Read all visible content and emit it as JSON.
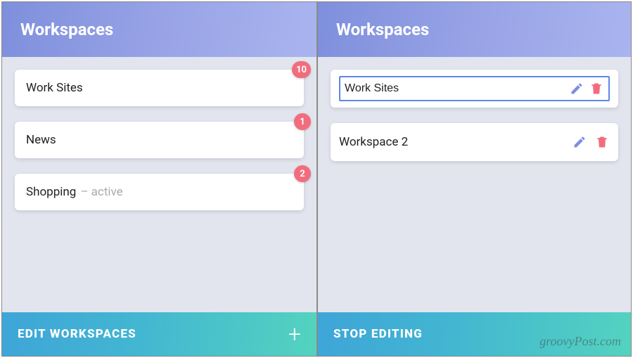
{
  "left": {
    "header": {
      "title": "Workspaces"
    },
    "items": [
      {
        "label": "Work Sites",
        "badge": "10"
      },
      {
        "label": "News",
        "badge": "1"
      },
      {
        "label": "Shopping",
        "secondary": "– active",
        "badge": "2"
      }
    ],
    "footer": {
      "label": "EDIT WORKSPACES",
      "plus": "+"
    }
  },
  "right": {
    "header": {
      "title": "Workspaces"
    },
    "items": [
      {
        "label": "Work Sites",
        "editing": true
      },
      {
        "label": "Workspace 2",
        "editing": false
      }
    ],
    "footer": {
      "label": "STOP EDITING"
    }
  },
  "watermark": "groovyPost.com",
  "colors": {
    "badge": "#f16d7d",
    "pencil": "#7d8ee0",
    "trash": "#f16d7d",
    "selection_border": "#5f87e8"
  }
}
